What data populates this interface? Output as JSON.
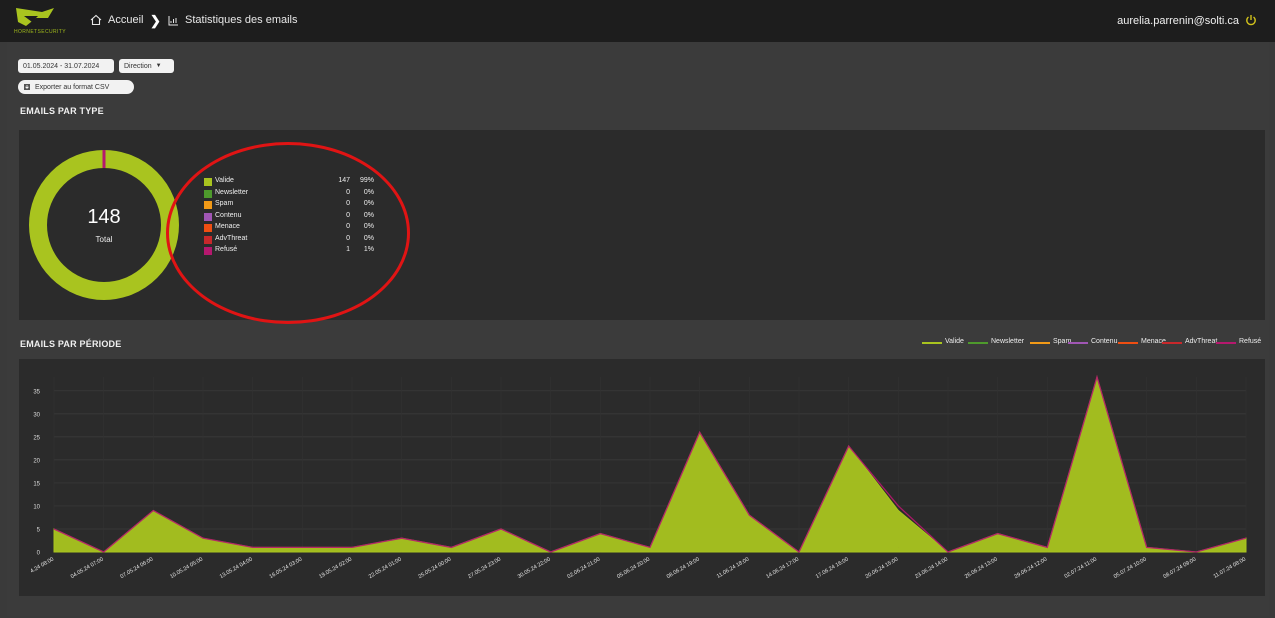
{
  "header": {
    "logo_text": "HORNETSECURITY",
    "breadcrumb_home": "Accueil",
    "breadcrumb_current": "Statistiques des emails",
    "user_email": "aurelia.parrenin@solti.ca"
  },
  "filters": {
    "date_range": "01.05.2024 - 31.07.2024",
    "direction_label": "Direction",
    "export_label": "Exporter au format CSV"
  },
  "type_section": {
    "title": "EMAILS PAR TYPE",
    "total": "148",
    "total_label": "Total",
    "legend": [
      {
        "name": "Valide",
        "count": "147",
        "percent": "99%",
        "color": "#a9c41f"
      },
      {
        "name": "Newsletter",
        "count": "0",
        "percent": "0%",
        "color": "#4e9a2c"
      },
      {
        "name": "Spam",
        "count": "0",
        "percent": "0%",
        "color": "#f29a17"
      },
      {
        "name": "Contenu",
        "count": "0",
        "percent": "0%",
        "color": "#a056b4"
      },
      {
        "name": "Menace",
        "count": "0",
        "percent": "0%",
        "color": "#ef4e12"
      },
      {
        "name": "AdvThreat",
        "count": "0",
        "percent": "0%",
        "color": "#c8282b"
      },
      {
        "name": "Refusé",
        "count": "1",
        "percent": "1%",
        "color": "#b5186e"
      }
    ]
  },
  "period_section": {
    "title": "EMAILS PAR PÉRIODE",
    "legend": [
      {
        "name": "Valide",
        "color": "#a9c41f"
      },
      {
        "name": "Newsletter",
        "color": "#4e9a2c"
      },
      {
        "name": "Spam",
        "color": "#f29a17"
      },
      {
        "name": "Contenu",
        "color": "#a056b4"
      },
      {
        "name": "Menace",
        "color": "#ef4e12"
      },
      {
        "name": "AdvThreat",
        "color": "#c8282b"
      },
      {
        "name": "Refusé",
        "color": "#b5186e"
      }
    ]
  },
  "chart_data": [
    {
      "type": "pie",
      "labels": [
        "Valide",
        "Newsletter",
        "Spam",
        "Contenu",
        "Menace",
        "AdvThreat",
        "Refusé"
      ],
      "values": [
        147,
        0,
        0,
        0,
        0,
        0,
        1
      ],
      "colors": [
        "#a9c41f",
        "#4e9a2c",
        "#f29a17",
        "#a056b4",
        "#ef4e12",
        "#c8282b",
        "#b5186e"
      ],
      "donut": true
    },
    {
      "type": "area",
      "categories": [
        "4.24 08:00",
        "04.05.24 07:00",
        "07.05.24 06:00",
        "10.05.24 05:00",
        "13.05.24 04:00",
        "16.05.24 03:00",
        "19.05.24 02:00",
        "22.05.24 01:00",
        "25.05.24 00:00",
        "27.05.24 23:00",
        "30.05.24 22:00",
        "02.06.24 21:00",
        "05.06.24 20:00",
        "08.06.24 19:00",
        "11.06.24 18:00",
        "14.06.24 17:00",
        "17.06.24 16:00",
        "20.06.24 15:00",
        "23.06.24 14:00",
        "26.06.24 13:00",
        "29.06.24 12:00",
        "02.07.24 11:00",
        "05.07.24 10:00",
        "08.07.24 09:00",
        "11.07.24 08:00"
      ],
      "series": [
        {
          "name": "Valide",
          "color": "#a9c41f",
          "values": [
            5,
            0,
            9,
            3,
            1,
            1,
            1,
            3,
            1,
            5,
            0,
            4,
            1,
            26,
            8,
            0,
            23,
            9,
            0,
            4,
            1,
            38,
            1,
            0,
            3
          ]
        },
        {
          "name": "Refusé",
          "color": "#b5186e",
          "values": [
            0,
            0,
            0,
            0,
            0,
            0,
            0,
            0,
            0,
            0,
            0,
            0,
            0,
            0,
            0,
            0,
            0,
            1,
            0,
            0,
            0,
            0,
            0,
            0,
            0
          ]
        }
      ],
      "y_ticks": [
        0,
        5,
        10,
        15,
        20,
        25,
        30,
        35
      ],
      "ylim": [
        0,
        38
      ],
      "grid": true,
      "legend": "top-right"
    }
  ]
}
